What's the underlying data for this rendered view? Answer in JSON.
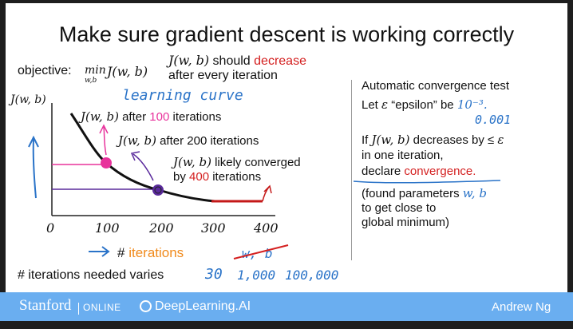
{
  "title": "Make sure gradient descent is working correctly",
  "objective": {
    "label": "objective:",
    "min_op": "min",
    "min_sub": "w,b",
    "expr": "J(w, b)"
  },
  "note": {
    "expr": "J(w, b)",
    "should": " should ",
    "decrease": "decrease",
    "line2": "after every iteration"
  },
  "plot": {
    "ylabel": "J(w, b)",
    "annotation_learning_curve": "learning curve",
    "ann100": {
      "expr": "J(w, b)",
      "pre": " after ",
      "num": "100",
      "post": " iterations"
    },
    "ann200": {
      "expr": "J(w, b)",
      "text": " after 200 iterations"
    },
    "ann400": {
      "expr": "J(w, b)",
      "line1": " likely converged",
      "line2_pre": "by ",
      "num": "400",
      "line2_post": " iterations"
    },
    "ticks": [
      "0",
      "100",
      "200",
      "300",
      "400"
    ],
    "xlabel_hash": "#",
    "xlabel_word": "iterations",
    "crossed": "w, b"
  },
  "varies": {
    "text": "# iterations needed varies",
    "v1": "30",
    "v2": "1,000",
    "v3": "100,000"
  },
  "right": {
    "heading": "Automatic convergence test",
    "let": "Let",
    "eps": "ε",
    "epsilon_word": "“epsilon” be",
    "eps_value": "10⁻³.",
    "eps_hand": "0.001",
    "if_pre": "If",
    "if_expr": "J(w, b)",
    "if_post": "decreases by ≤",
    "if_eps": "ε",
    "line_iter": "in one iteration,",
    "declare": "declare",
    "convergence": "convergence.",
    "found1": "(found parameters",
    "found_wb": "w, b",
    "found2": "to get close to",
    "found3": "global minimum)"
  },
  "footer": {
    "stanford": "Stanford",
    "online": "ONLINE",
    "dl": "DeepLearning.AI",
    "author": "Andrew Ng",
    "bg": "#6aaef0"
  },
  "colors": {
    "red": "#d42020",
    "magenta": "#e8339c",
    "orange": "#f08a1c",
    "purple": "#5a2a9c",
    "handBlue": "#2a73c8"
  }
}
